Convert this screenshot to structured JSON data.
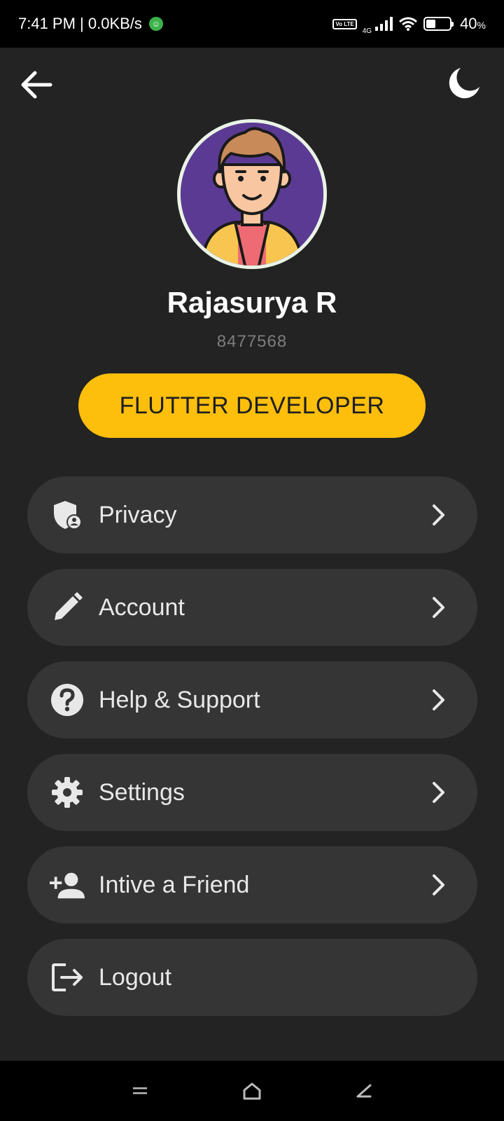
{
  "status_bar": {
    "time_speed": "7:41 PM | 0.0KB/s",
    "volte_label": "Vo LTE",
    "network_label": "4G",
    "battery_text": "40",
    "battery_unit": "%",
    "battery_level": 0.4
  },
  "header": {
    "back_icon": "arrow-left-icon",
    "theme_icon": "moon-icon"
  },
  "profile": {
    "name": "Rajasurya R",
    "id": "8477568",
    "role": "FLUTTER DEVELOPER",
    "avatar_icon": "man-avatar-illustration"
  },
  "menu": {
    "items": [
      {
        "label": "Privacy",
        "icon": "shield-user-icon"
      },
      {
        "label": "Account",
        "icon": "pencil-icon"
      },
      {
        "label": "Help & Support",
        "icon": "help-circle-icon"
      },
      {
        "label": "Settings",
        "icon": "gear-icon"
      },
      {
        "label": "Intive a Friend",
        "icon": "person-add-icon"
      },
      {
        "label": "Logout",
        "icon": "logout-icon"
      }
    ]
  },
  "colors": {
    "background": "#232323",
    "menu_item": "#353535",
    "accent": "#fdbf0c"
  }
}
